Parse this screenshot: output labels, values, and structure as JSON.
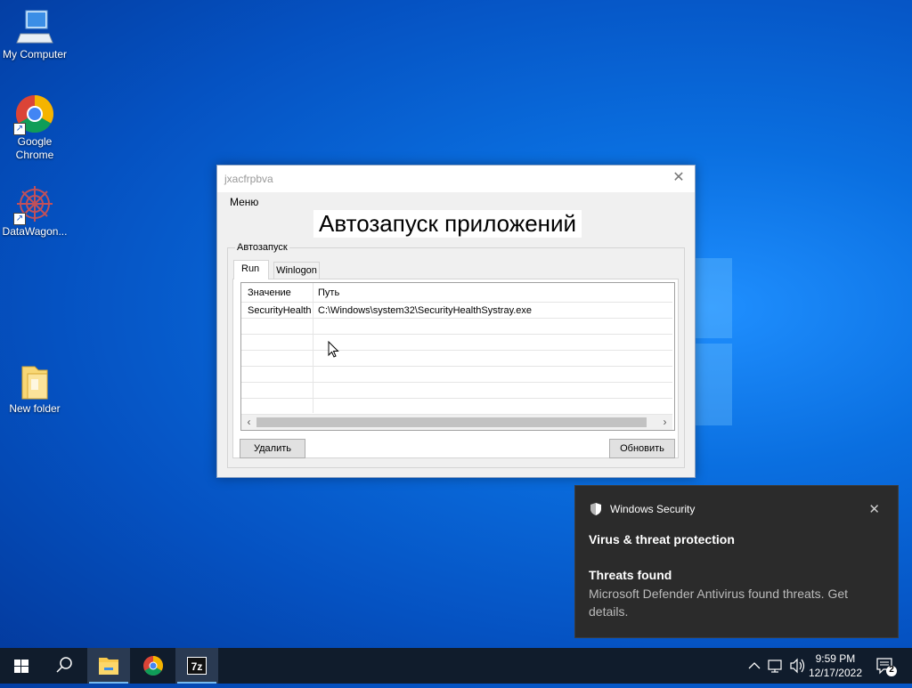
{
  "desktop": {
    "icons": [
      {
        "label": "My Computer"
      },
      {
        "label": "Google Chrome"
      },
      {
        "label": "DataWagon..."
      },
      {
        "label": "New folder"
      }
    ]
  },
  "window": {
    "title": "jxacfrpbva",
    "menu_label": "Меню",
    "heading": "Автозапуск приложений",
    "group_label": "Автозапуск",
    "tabs": [
      {
        "label": "Run"
      },
      {
        "label": "Winlogon"
      }
    ],
    "table": {
      "columns": [
        "Значение",
        "Путь"
      ],
      "rows": [
        {
          "name": "SecurityHealth",
          "path": "C:\\Windows\\system32\\SecurityHealthSystray.exe"
        }
      ]
    },
    "delete_label": "Удалить",
    "refresh_label": "Обновить"
  },
  "notification": {
    "app": "Windows Security",
    "title": "Virus & threat protection",
    "subtitle": "Threats found",
    "body": "Microsoft Defender Antivirus found threats. Get details."
  },
  "taskbar": {
    "time": "9:59 PM",
    "date": "12/17/2022",
    "notification_count": "2",
    "apps": [
      "start-icon",
      "search-icon",
      "file-explorer-icon",
      "chrome-icon",
      "7zip-icon"
    ]
  },
  "colors": {
    "desktop": "#0a6fe0",
    "taskbar": "#101c2c",
    "toast": "#2b2b2b",
    "accent": "#76b9ed"
  }
}
